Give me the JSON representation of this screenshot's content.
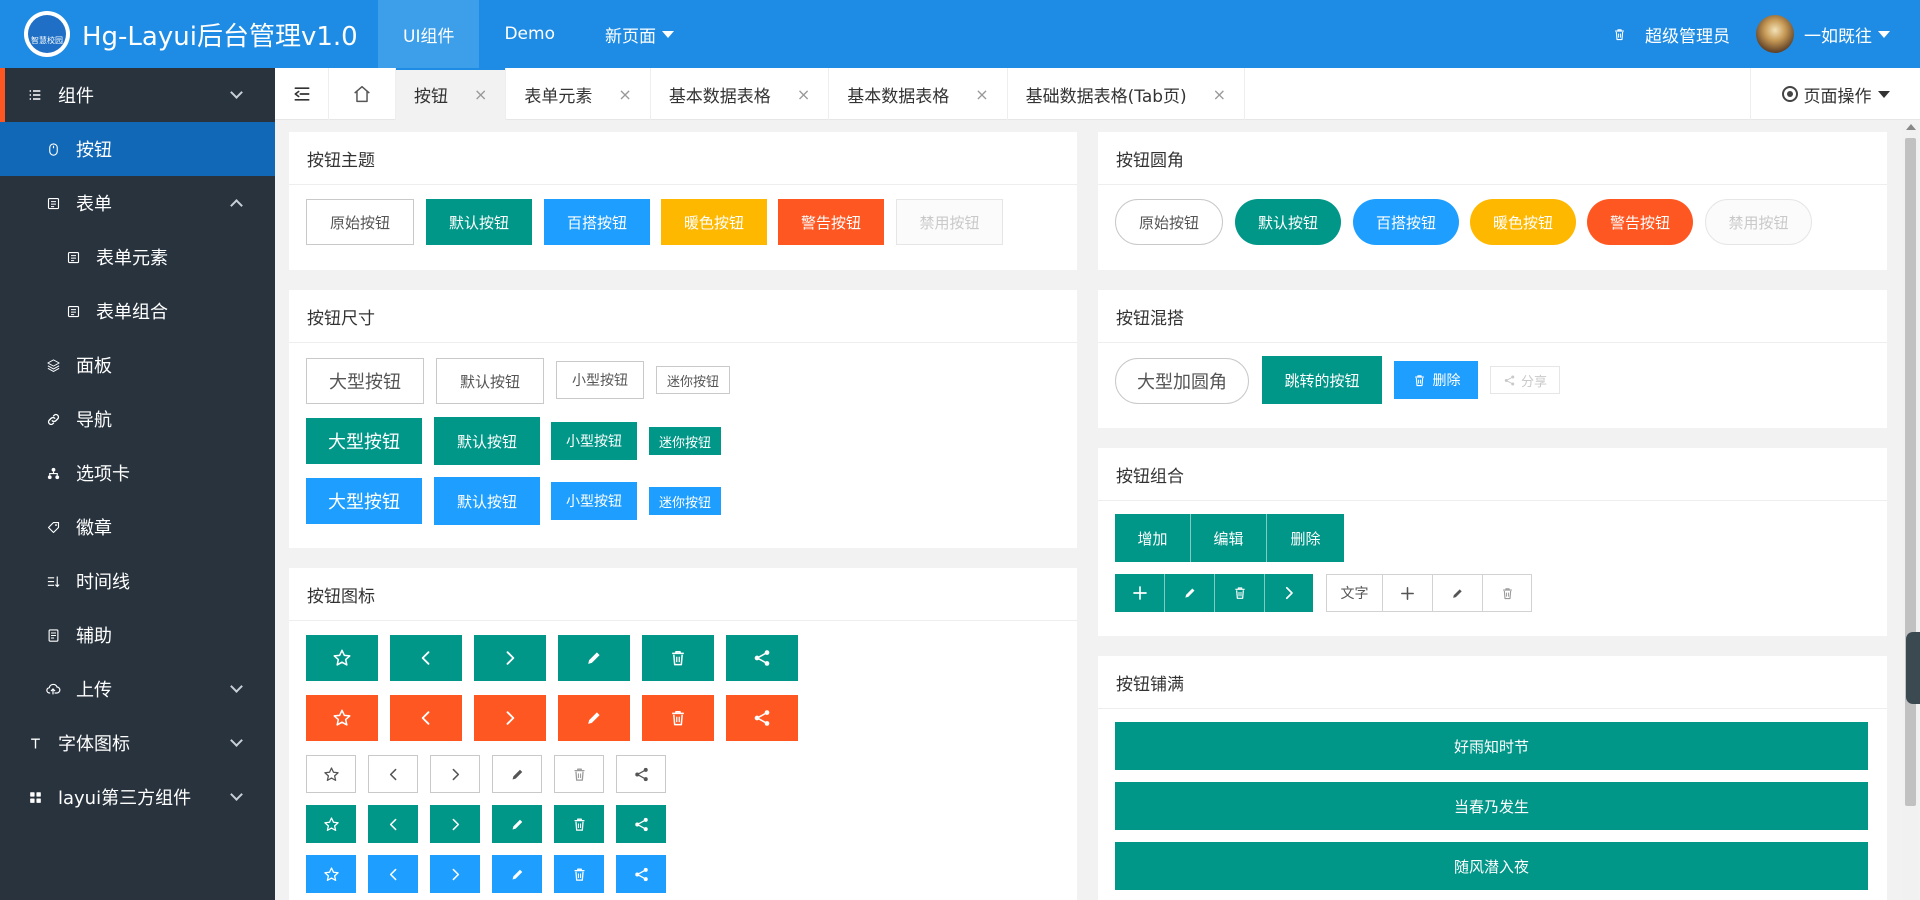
{
  "header": {
    "logo_text": "智慧校园",
    "title": "Hg-Layui后台管理v1.0",
    "nav": [
      {
        "label": "UI组件",
        "active": true
      },
      {
        "label": "Demo",
        "active": false
      },
      {
        "label": "新页面",
        "active": false,
        "dropdown": true
      }
    ],
    "admin_label": "超级管理员",
    "user_name": "一如既往"
  },
  "sidebar": {
    "items": [
      {
        "label": "组件",
        "icon": "list-icon"
      },
      {
        "label": "按钮",
        "icon": "mouse-icon"
      },
      {
        "label": "表单",
        "icon": "form-icon"
      },
      {
        "label": "表单元素",
        "icon": "form-icon"
      },
      {
        "label": "表单组合",
        "icon": "form-icon"
      },
      {
        "label": "面板",
        "icon": "layers-icon"
      },
      {
        "label": "导航",
        "icon": "link-icon"
      },
      {
        "label": "选项卡",
        "icon": "tree-icon"
      },
      {
        "label": "徽章",
        "icon": "tag-icon"
      },
      {
        "label": "时间线",
        "icon": "timeline-icon"
      },
      {
        "label": "辅助",
        "icon": "note-icon"
      },
      {
        "label": "上传",
        "icon": "cloud-upload-icon"
      },
      {
        "label": "字体图标",
        "icon": "font-icon"
      },
      {
        "label": "layui第三方组件",
        "icon": "apps-icon"
      }
    ]
  },
  "tabbar": {
    "tabs": [
      {
        "label": "按钮",
        "active": true
      },
      {
        "label": "表单元素",
        "active": false
      },
      {
        "label": "基本数据表格",
        "active": false
      },
      {
        "label": "基本数据表格",
        "active": false
      },
      {
        "label": "基础数据表格(Tab页)",
        "active": false
      }
    ],
    "close_glyph": "×",
    "page_ops": "页面操作"
  },
  "cards": {
    "theme": {
      "title": "按钮主题",
      "buttons": [
        "原始按钮",
        "默认按钮",
        "百搭按钮",
        "暖色按钮",
        "警告按钮",
        "禁用按钮"
      ]
    },
    "radius": {
      "title": "按钮圆角",
      "buttons": [
        "原始按钮",
        "默认按钮",
        "百搭按钮",
        "暖色按钮",
        "警告按钮",
        "禁用按钮"
      ]
    },
    "size": {
      "title": "按钮尺寸",
      "labels": [
        "大型按钮",
        "默认按钮",
        "小型按钮",
        "迷你按钮"
      ]
    },
    "mix": {
      "title": "按钮混搭",
      "big_round": "大型加圆角",
      "jump": "跳转的按钮",
      "delete": "删除",
      "share": "分享"
    },
    "icons": {
      "title": "按钮图标"
    },
    "group": {
      "title": "按钮组合",
      "row1": [
        "增加",
        "编辑",
        "删除"
      ],
      "text": "文字"
    },
    "fluid": {
      "title": "按钮铺满",
      "buttons": [
        "好雨知时节",
        "当春乃发生",
        "随风潜入夜"
      ]
    }
  },
  "colors": {
    "header": "#1e8ce4",
    "sidebar": "#28333e",
    "sidebar_active": "#1168b7",
    "default": "#009688",
    "normal": "#1e9fff",
    "warm": "#ffb800",
    "danger": "#ff5722"
  }
}
